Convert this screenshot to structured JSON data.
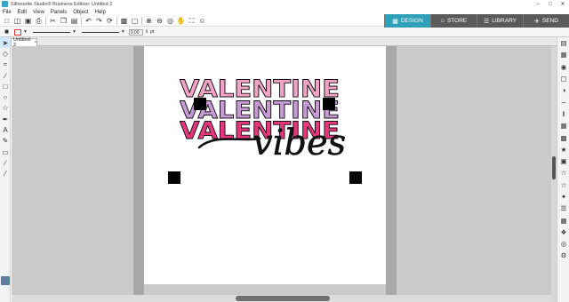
{
  "window": {
    "title": "Silhouette Studio® Business Edition: Untitled-2",
    "controls": [
      "–",
      "□",
      "✕"
    ]
  },
  "menu": [
    "File",
    "Edit",
    "View",
    "Panels",
    "Object",
    "Help"
  ],
  "toolbar": {
    "icons": [
      "new-file-icon",
      "open-file-icon",
      "save-icon",
      "print-icon",
      "cut-icon",
      "copy-icon",
      "paste-icon",
      "undo-icon",
      "redo-icon",
      "redraw-icon",
      "select-all-icon",
      "clear-selection-icon",
      "zoom-in-icon",
      "zoom-out-icon",
      "zoom-select-icon",
      "pan-icon",
      "fit-page-icon",
      "user-icon"
    ]
  },
  "tabs": [
    {
      "label": "DESIGN",
      "icon": "design-icon",
      "active": true
    },
    {
      "label": "STORE",
      "icon": "store-icon",
      "active": false
    },
    {
      "label": "LIBRARY",
      "icon": "library-icon",
      "active": false
    },
    {
      "label": "SEND",
      "icon": "send-icon",
      "active": false
    }
  ],
  "propbar": {
    "line_width": "0.00",
    "unit": "pt"
  },
  "document": {
    "tab_label": "Untitled-2",
    "close": "×"
  },
  "artwork": {
    "line1": "VALENTINE",
    "line2": "VALENTINE",
    "line3": "VALENTINE",
    "script": "vibes",
    "colors": {
      "line1": "#f3a2c7",
      "line2": "#c79ad6",
      "line3": "#e8367e",
      "script": "#111111"
    }
  },
  "colors": {
    "accent": "#2fa0b7",
    "tab_inactive": "#5a5a5a",
    "workspace": "#cacaca"
  }
}
